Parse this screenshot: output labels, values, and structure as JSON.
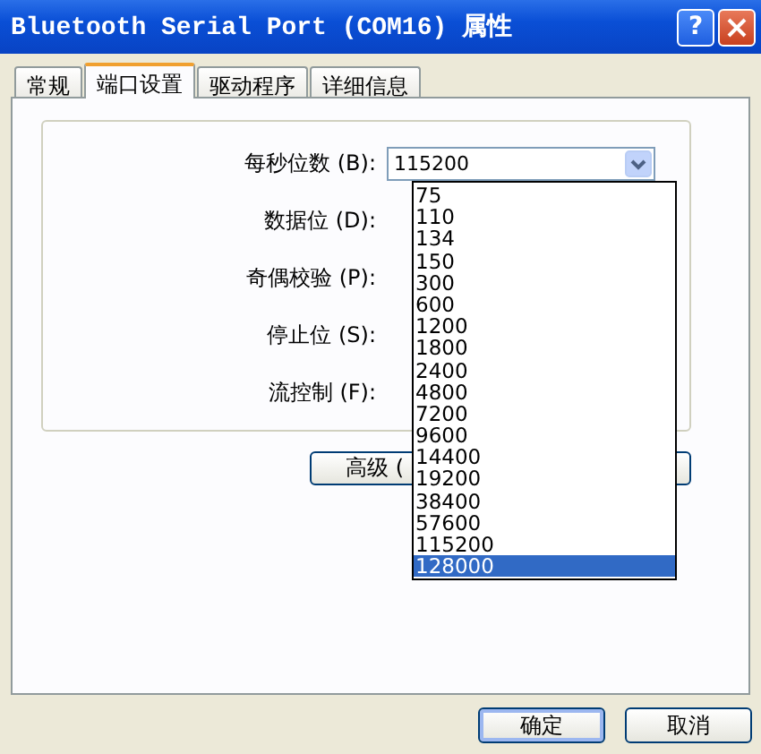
{
  "window": {
    "title": "Bluetooth Serial Port (COM16) 属性",
    "help_button": "?"
  },
  "tabs": [
    {
      "label": "常规",
      "selected": false
    },
    {
      "label": "端口设置",
      "selected": true
    },
    {
      "label": "驱动程序",
      "selected": false
    },
    {
      "label": "详细信息",
      "selected": false
    }
  ],
  "fields": [
    {
      "label": "每秒位数 (B):",
      "value": "115200"
    },
    {
      "label": "数据位 (D):"
    },
    {
      "label": "奇偶校验 (P):"
    },
    {
      "label": "停止位 (S):"
    },
    {
      "label": "流控制 (F):"
    }
  ],
  "dropdown": {
    "items": [
      {
        "label": "75",
        "selected": false
      },
      {
        "label": "110",
        "selected": false
      },
      {
        "label": "134",
        "selected": false
      },
      {
        "label": "150",
        "selected": false
      },
      {
        "label": "300",
        "selected": false
      },
      {
        "label": "600",
        "selected": false
      },
      {
        "label": "1200",
        "selected": false
      },
      {
        "label": "1800",
        "selected": false
      },
      {
        "label": "2400",
        "selected": false
      },
      {
        "label": "4800",
        "selected": false
      },
      {
        "label": "7200",
        "selected": false
      },
      {
        "label": "9600",
        "selected": false
      },
      {
        "label": "14400",
        "selected": false
      },
      {
        "label": "19200",
        "selected": false
      },
      {
        "label": "38400",
        "selected": false
      },
      {
        "label": "57600",
        "selected": false
      },
      {
        "label": "115200",
        "selected": false
      },
      {
        "label": "128000",
        "selected": true
      }
    ]
  },
  "advanced_button": "高级 (",
  "buttons": [
    "确定",
    "取消"
  ]
}
